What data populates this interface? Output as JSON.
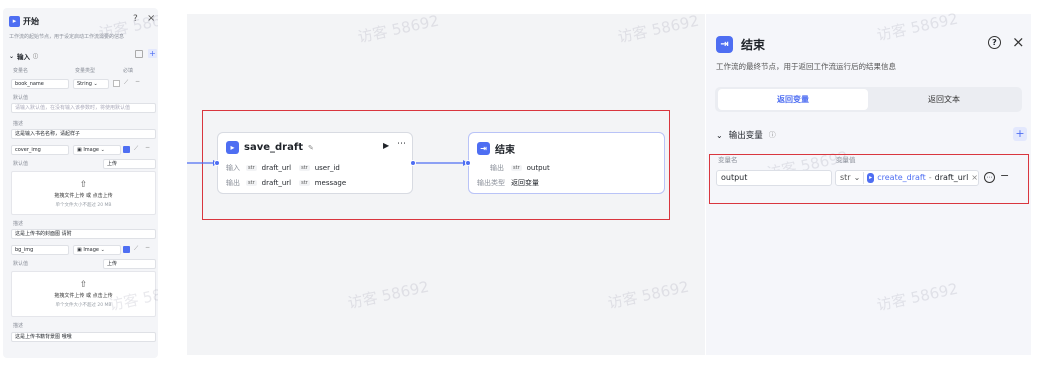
{
  "watermark": "访客 58692",
  "left_panel": {
    "title": "开始",
    "subtitle": "工作流的起始节点，用于设定启动工作流需要的信息",
    "section": "输入",
    "col_headers": [
      "变量名",
      "变量类型",
      "必填"
    ],
    "fields": [
      {
        "name": "book_name",
        "type": "String",
        "default_label": "默认值",
        "default_placeholder": "请输入默认值，在没有输入该参数时，将使用默认值",
        "desc_label": "描述",
        "desc": "这是输入书名名称，请起样子"
      },
      {
        "name": "cover_img",
        "type": "Image",
        "default_label": "默认值",
        "default_value": "上传",
        "upload_text": "拖拽文件上传 或 点击上传",
        "upload_hint": "单个文件大小不超过 20 MB",
        "desc_label": "描述",
        "desc": "这是上传书的封面图 请附"
      },
      {
        "name": "bg_img",
        "type": "Image",
        "default_label": "默认值",
        "default_value": "上传",
        "upload_text": "拖拽文件上传 或 点击上传",
        "upload_hint": "单个文件大小不超过 20 MB",
        "desc_label": "描述",
        "desc": "这是上传书籍背景图 哦哦"
      }
    ]
  },
  "canvas": {
    "node_save": {
      "title": "save_draft",
      "input_label": "输入",
      "output_label": "输出",
      "inputs": [
        {
          "tag": "str",
          "name": "draft_url"
        },
        {
          "tag": "str",
          "name": "user_id"
        }
      ],
      "outputs": [
        {
          "tag": "str",
          "name": "draft_url"
        },
        {
          "tag": "str",
          "name": "message"
        }
      ]
    },
    "node_end": {
      "title": "结束",
      "output_label": "输出",
      "output_tag": "str",
      "output_name": "output",
      "type_label": "输出类型",
      "type_value": "返回变量"
    }
  },
  "right_panel": {
    "title": "结束",
    "description": "工作流的最终节点，用于返回工作流运行后的结果信息",
    "tabs": [
      "返回变量",
      "返回文本"
    ],
    "active_tab": 0,
    "section": "输出变量",
    "col_var_name": "变量名",
    "col_var_value": "变量值",
    "var_name": "output",
    "var_type": "str",
    "ref_node": "create_draft",
    "ref_sep": " - ",
    "ref_field": "draft_url"
  },
  "colors": {
    "accent": "#4e6ef2",
    "highlight": "#d9363e",
    "canvas_bg": "#f3f4f6",
    "panel_bg": "#f5f6fa"
  }
}
